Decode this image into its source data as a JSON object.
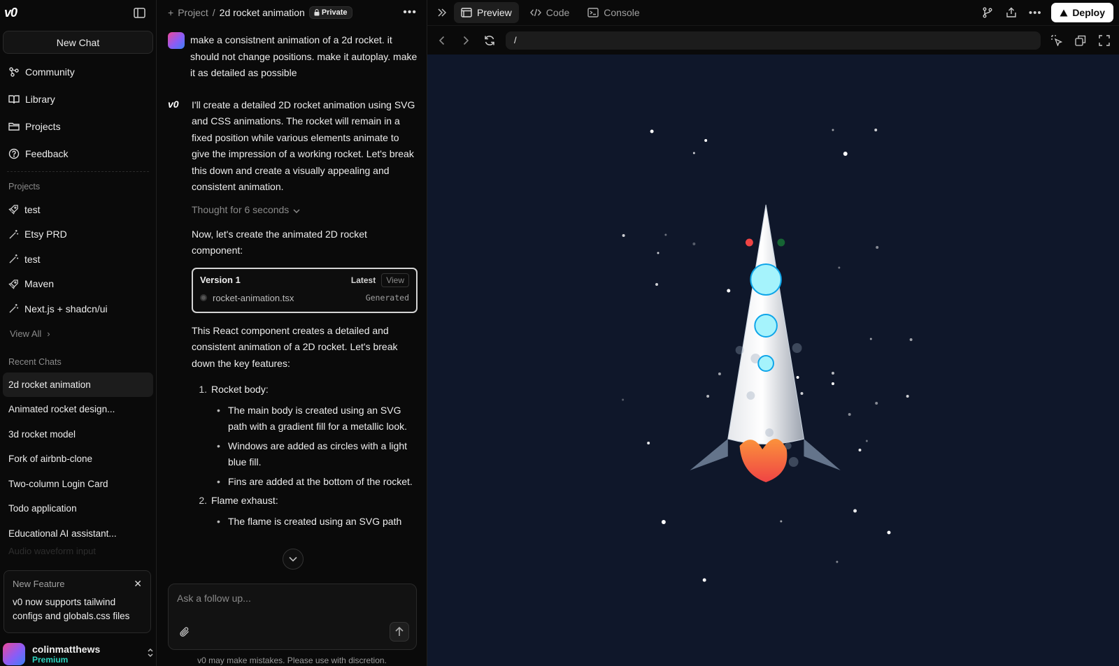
{
  "sidebar": {
    "logo": "v0",
    "new_chat": "New Chat",
    "nav": [
      {
        "label": "Community",
        "icon": "community-icon"
      },
      {
        "label": "Library",
        "icon": "book-icon"
      },
      {
        "label": "Projects",
        "icon": "folder-icon"
      },
      {
        "label": "Feedback",
        "icon": "help-icon"
      }
    ],
    "projects_title": "Projects",
    "projects": [
      {
        "label": "test",
        "icon": "rocket-icon"
      },
      {
        "label": "Etsy PRD",
        "icon": "wand-icon"
      },
      {
        "label": "test",
        "icon": "wand-icon"
      },
      {
        "label": "Maven",
        "icon": "rocket-icon"
      },
      {
        "label": "Next.js + shadcn/ui",
        "icon": "wand-icon"
      }
    ],
    "view_all": "View All",
    "recent_title": "Recent Chats",
    "recent": [
      "2d rocket animation",
      "Animated rocket design...",
      "3d rocket model",
      "Fork of airbnb-clone",
      "Two-column Login Card",
      "Todo application",
      "Educational AI assistant..."
    ],
    "recent_faded": "Audio waveform input",
    "feature": {
      "title": "New Feature",
      "body": "v0 now supports tailwind configs and globals.css files"
    },
    "user": {
      "name": "colinmatthews",
      "plan": "Premium"
    }
  },
  "chat": {
    "breadcrumb_project": "Project",
    "breadcrumb_sep": "/",
    "title": "2d rocket animation",
    "private_label": "Private",
    "user_message": "make a consistnent animation of a 2d rocket. it should not change positions. make it autoplay. make it as detailed as possible",
    "assistant_intro": "I'll create a detailed 2D rocket animation using SVG and CSS animations. The rocket will remain in a fixed position while various elements animate to give the impression of a working rocket. Let's break this down and create a visually appealing and consistent animation.",
    "thought": "Thought for 6 seconds",
    "lead": "Now, let's create the animated 2D rocket component:",
    "version": {
      "title": "Version 1",
      "latest": "Latest",
      "view": "View",
      "file": "rocket-animation.tsx",
      "status": "Generated"
    },
    "summary": "This React component creates a detailed and consistent animation of a 2D rocket. Let's break down the key features:",
    "features": [
      {
        "num": "1.",
        "title": "Rocket body:",
        "points": [
          "The main body is created using an SVG path with a gradient fill for a metallic look.",
          "Windows are added as circles with a light blue fill.",
          "Fins are added at the bottom of the rocket."
        ]
      },
      {
        "num": "2.",
        "title": "Flame exhaust:",
        "points": [
          "The flame is created using an SVG path"
        ]
      }
    ],
    "input_placeholder": "Ask a follow up...",
    "disclaimer": "v0 may make mistakes. Please use with discretion."
  },
  "preview": {
    "tabs": [
      {
        "label": "Preview",
        "icon": "window-icon",
        "active": true
      },
      {
        "label": "Code",
        "icon": "code-icon",
        "active": false
      },
      {
        "label": "Console",
        "icon": "terminal-icon",
        "active": false
      }
    ],
    "deploy": "Deploy",
    "url": "/",
    "colors": {
      "canvas_bg": "#0f172a",
      "window_fill": "#a5f3fc",
      "window_stroke": "#0ea5e9",
      "fin": "#64748b",
      "flame_outer": "#ef4444",
      "flame_inner": "#fb923c",
      "light_red": "#ef4444",
      "light_green": "#14532d"
    }
  }
}
